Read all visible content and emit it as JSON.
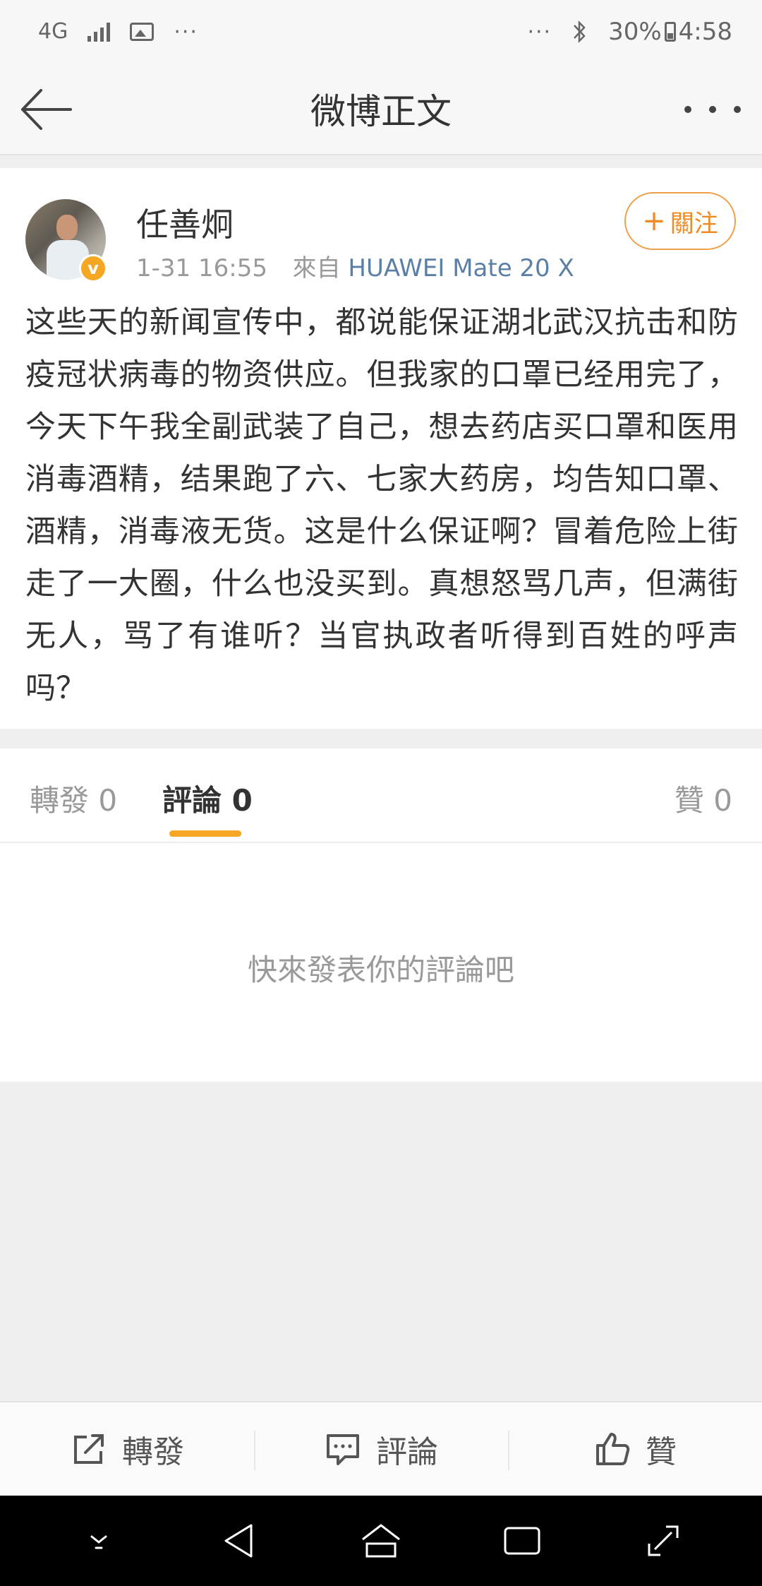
{
  "status_bar": {
    "network": "4G",
    "more_left": "···",
    "more_right": "···",
    "battery": "30%",
    "time": "4:58"
  },
  "nav": {
    "title": "微博正文"
  },
  "post": {
    "author": "任善炯",
    "time": "1-31 16:55",
    "source_prefix": "來自",
    "source": "HUAWEI Mate 20 X",
    "follow_label": "關注",
    "text": "这些天的新闻宣传中，都说能保证湖北武汉抗击和防疫冠状病毒的物资供应。但我家的口罩已经用完了，今天下午我全副武装了自己，想去药店买口罩和医用消毒酒精，结果跑了六、七家大药房，均告知口罩、酒精，消毒液无货。这是什么保证啊？冒着危险上街走了一大圈，什么也没买到。真想怒骂几声，但满街无人，骂了有谁听？当官执政者听得到百姓的呼声吗？"
  },
  "tabs": {
    "repost": "轉發 0",
    "comment": "評論 0",
    "like": "贊 0"
  },
  "comments": {
    "empty_hint": "快來發表你的評論吧"
  },
  "actions": {
    "repost": "轉發",
    "comment": "評論",
    "like": "贊"
  },
  "colors": {
    "accent": "#f5a623",
    "follow": "#f08a24",
    "source_link": "#5b7fa6"
  }
}
